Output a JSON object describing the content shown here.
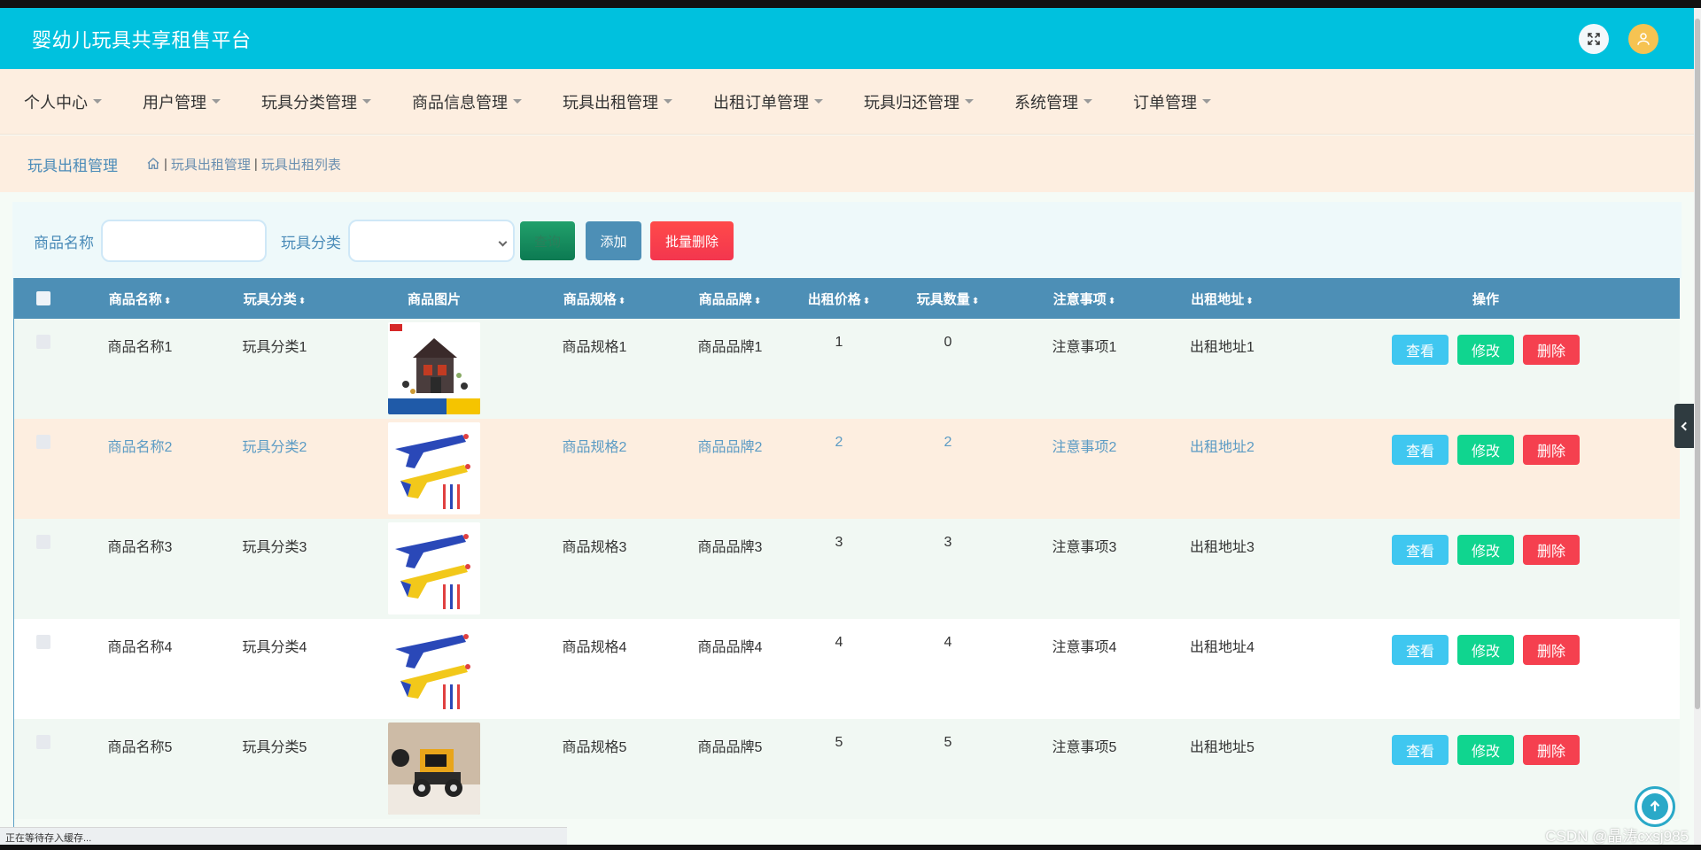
{
  "app": {
    "title": "婴幼儿玩具共享租售平台"
  },
  "nav": {
    "items": [
      {
        "label": "个人中心"
      },
      {
        "label": "用户管理"
      },
      {
        "label": "玩具分类管理"
      },
      {
        "label": "商品信息管理"
      },
      {
        "label": "玩具出租管理"
      },
      {
        "label": "出租订单管理"
      },
      {
        "label": "玩具归还管理"
      },
      {
        "label": "系统管理"
      },
      {
        "label": "订单管理"
      }
    ]
  },
  "breadcrumb": {
    "title": "玩具出租管理",
    "path1": "玩具出租管理",
    "path2": "玩具出租列表",
    "separator": "|"
  },
  "search": {
    "name_label": "商品名称",
    "name_value": "",
    "category_label": "玩具分类",
    "category_value": "",
    "search_button": "查询",
    "add_button": "添加",
    "batch_delete_button": "批量删除"
  },
  "table": {
    "columns": [
      "商品名称",
      "玩具分类",
      "商品图片",
      "商品规格",
      "商品品牌",
      "出租价格",
      "玩具数量",
      "注意事项",
      "出租地址",
      "操作"
    ],
    "sort_glyph": "⬍",
    "rows": [
      {
        "name": "商品名称1",
        "category": "玩具分类1",
        "spec": "商品规格1",
        "brand": "商品品牌1",
        "price": "1",
        "qty": "0",
        "notes": "注意事项1",
        "address": "出租地址1",
        "image": "lego-temple"
      },
      {
        "name": "商品名称2",
        "category": "玩具分类2",
        "spec": "商品规格2",
        "brand": "商品品牌2",
        "price": "2",
        "qty": "2",
        "notes": "注意事项2",
        "address": "出租地址2",
        "image": "toy-guns"
      },
      {
        "name": "商品名称3",
        "category": "玩具分类3",
        "spec": "商品规格3",
        "brand": "商品品牌3",
        "price": "3",
        "qty": "3",
        "notes": "注意事项3",
        "address": "出租地址3",
        "image": "toy-guns"
      },
      {
        "name": "商品名称4",
        "category": "玩具分类4",
        "spec": "商品规格4",
        "brand": "商品品牌4",
        "price": "4",
        "qty": "4",
        "notes": "注意事项4",
        "address": "出租地址4",
        "image": "toy-guns"
      },
      {
        "name": "商品名称5",
        "category": "玩具分类5",
        "spec": "商品规格5",
        "brand": "商品品牌5",
        "price": "5",
        "qty": "5",
        "notes": "注意事项5",
        "address": "出租地址5",
        "image": "toy-truck"
      }
    ],
    "op_view": "查看",
    "op_edit": "修改",
    "op_delete": "删除"
  },
  "status_bar": {
    "text": "正在等待存入缓存..."
  },
  "watermark": "CSDN @晶涛cxsj985",
  "colors": {
    "header": "#00c1de",
    "nav_bg": "#fdeee0",
    "table_header": "#4d8fb6",
    "view": "#3fc7f0",
    "edit": "#10d58f",
    "delete": "#f5404f"
  },
  "icons": {
    "fullscreen": "fullscreen-icon",
    "avatar": "user-avatar-icon",
    "home": "home-icon",
    "back_to_top": "arrow-up-icon"
  }
}
